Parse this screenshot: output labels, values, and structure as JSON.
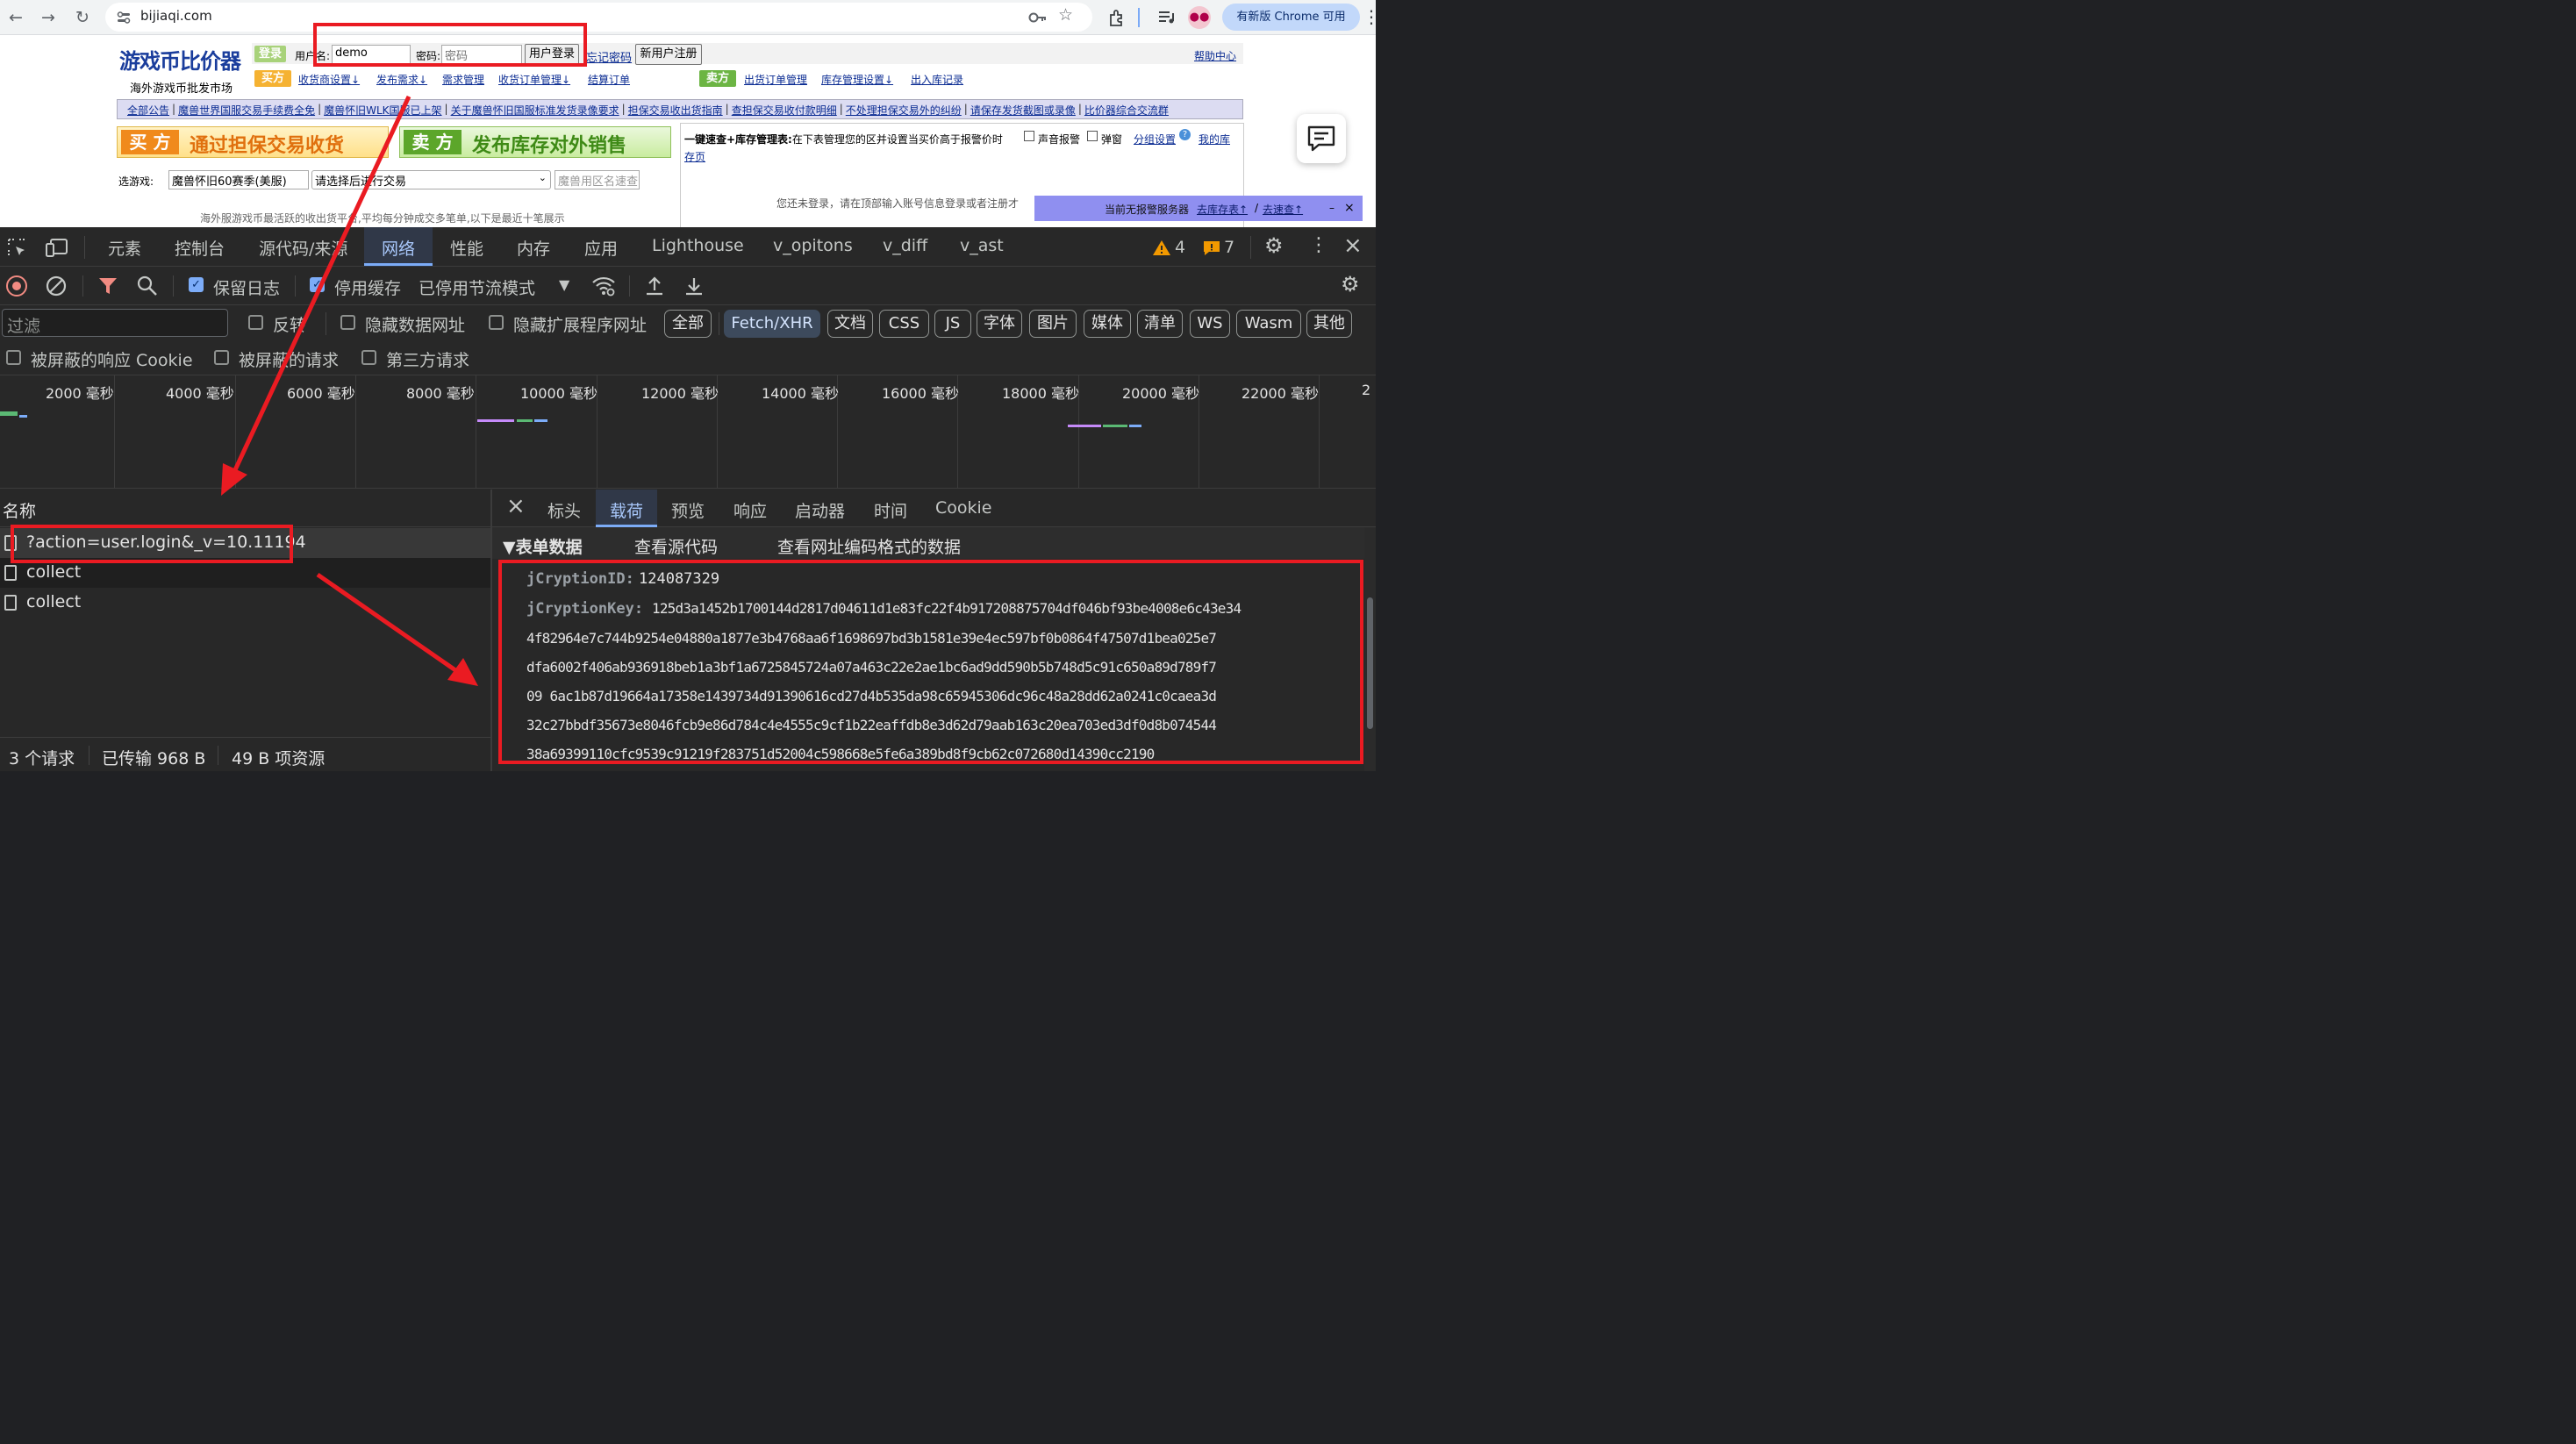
{
  "browser": {
    "url": "bijiaqi.com",
    "update_label": "有新版 Chrome 可用"
  },
  "webpage": {
    "logo_text": "游戏币比价器",
    "logo_subtitle": "海外游戏币批发市场",
    "login": {
      "tag": "登录",
      "username_label": "用户名:",
      "username_value": "demo",
      "password_label": "密码:",
      "password_placeholder": "密码",
      "login_button": "用户登录",
      "forgot_link": "忘记密码",
      "register_button": "新用户注册",
      "help_link": "帮助中心"
    },
    "buyer_tag": "买方",
    "buyer_links": [
      "收货商设置↓",
      "发布需求↓",
      "需求管理",
      "收货订单管理↓",
      "结算订单"
    ],
    "seller_tag": "卖方",
    "seller_links": [
      "出货订单管理",
      "库存管理设置↓",
      "出入库记录"
    ],
    "announcements": [
      "全部公告",
      "魔兽世界国服交易手续费全免",
      "魔兽怀旧WLK国服已上架",
      "关于魔兽怀旧国服标准发货录像要求",
      "担保交易收出货指南",
      "查担保交易收付款明细",
      "不处理担保交易外的纠纷",
      "请保存发货截图或录像",
      "比价器综合交流群"
    ],
    "banner_buy": {
      "tag": "买 方",
      "text": "通过担保交易收货"
    },
    "banner_sell": {
      "tag": "卖 方",
      "text": "发布库存对外销售"
    },
    "game_label": "选游戏:",
    "game_value": "魔兽怀旧60赛季(美服)",
    "trade_select": "请选择后进行交易",
    "server_search_placeholder": "魔兽用区名速查",
    "quick_bold": "一键速查+库存管理表:",
    "quick_text": "在下表管理您的区并设置当买价高于报警价时",
    "sound_alert": "声音报警",
    "popup": "弹窗",
    "group_setting": "分组设置",
    "my_stock_a": "我的库",
    "my_stock_b": "存页",
    "footer_text": "海外服游戏币最活跃的收出货平台,平均每分钟成交多笔单,以下是最近十笔展示",
    "login_hint": "您还未登录，请在顶部输入账号信息登录或者注册才",
    "alarm_text": "当前无报警服务器",
    "alarm_link1": "去库存表↑",
    "alarm_sep": "/",
    "alarm_link2": "去速查↑",
    "alarm_min": "–",
    "alarm_close": "×"
  },
  "devtools": {
    "tabs": [
      "元素",
      "控制台",
      "源代码/来源",
      "网络",
      "性能",
      "内存",
      "应用",
      "Lighthouse",
      "v_opitons",
      "v_diff",
      "v_ast"
    ],
    "active_tab": "网络",
    "warnings": "4",
    "errors": "7",
    "toolbar": {
      "preserve_log": "保留日志",
      "disable_cache": "停用缓存",
      "throttle": "已停用节流模式"
    },
    "filter": {
      "placeholder": "过滤",
      "invert": "反转",
      "hide_data_urls": "隐藏数据网址",
      "hide_ext_urls": "隐藏扩展程序网址",
      "types": [
        "全部",
        "Fetch/XHR",
        "文档",
        "CSS",
        "JS",
        "字体",
        "图片",
        "媒体",
        "清单",
        "WS",
        "Wasm",
        "其他"
      ],
      "active_type": "Fetch/XHR",
      "blocked_cookies": "被屏蔽的响应 Cookie",
      "blocked_requests": "被屏蔽的请求",
      "third_party": "第三方请求"
    },
    "timeline_ticks": [
      "2000 毫秒",
      "4000 毫秒",
      "6000 毫秒",
      "8000 毫秒",
      "10000 毫秒",
      "12000 毫秒",
      "14000 毫秒",
      "16000 毫秒",
      "18000 毫秒",
      "20000 毫秒",
      "22000 毫秒",
      "2"
    ],
    "requests": {
      "header": "名称",
      "rows": [
        "?action=user.login&_v=10.11194",
        "collect",
        "collect"
      ]
    },
    "detail_tabs": [
      "标头",
      "载荷",
      "预览",
      "响应",
      "启动器",
      "时间",
      "Cookie"
    ],
    "active_detail_tab": "载荷",
    "payload": {
      "section_title": "▼表单数据",
      "view_source": "查看源代码",
      "view_urlencoded": "查看网址编码格式的数据",
      "id_key": "jCryptionID:",
      "id_value": "124087329",
      "key_key": "jCryptionKey:",
      "key_lines": [
        "125d3a1452b1700144d2817d04611d1e83fc22f4b917208875704df046bf93be4008e6c43e34",
        "4f82964e7c744b9254e04880a1877e3b4768aa6f1698697bd3b1581e39e4ec597bf0b0864f47507d1bea025e7",
        "dfa6002f406ab936918beb1a3bf1a6725845724a07a463c22e2ae1bc6ad9dd590b5b748d5c91c650a89d789f7",
        "09 6ac1b87d19664a17358e1439734d91390616cd27d4b535da98c65945306dc96c48a28dd62a0241c0caea3d",
        "32c27bbdf35673e8046fcb9e86d784c4e4555c9cf1b22eaffdb8e3d62d79aab163c20ea703ed3df0d8b074544",
        "38a69399110cfc9539c91219f283751d52004c598668e5fe6a389bd8f9cb62c072680d14390cc2190"
      ]
    },
    "status": {
      "requests": "3 个请求",
      "transferred": "已传输 968 B",
      "resources": "49 B 项资源"
    }
  },
  "colors": {
    "annotation_red": "#ea1b22",
    "devtools_bg": "#282828",
    "active_blue": "#7cacf8"
  }
}
